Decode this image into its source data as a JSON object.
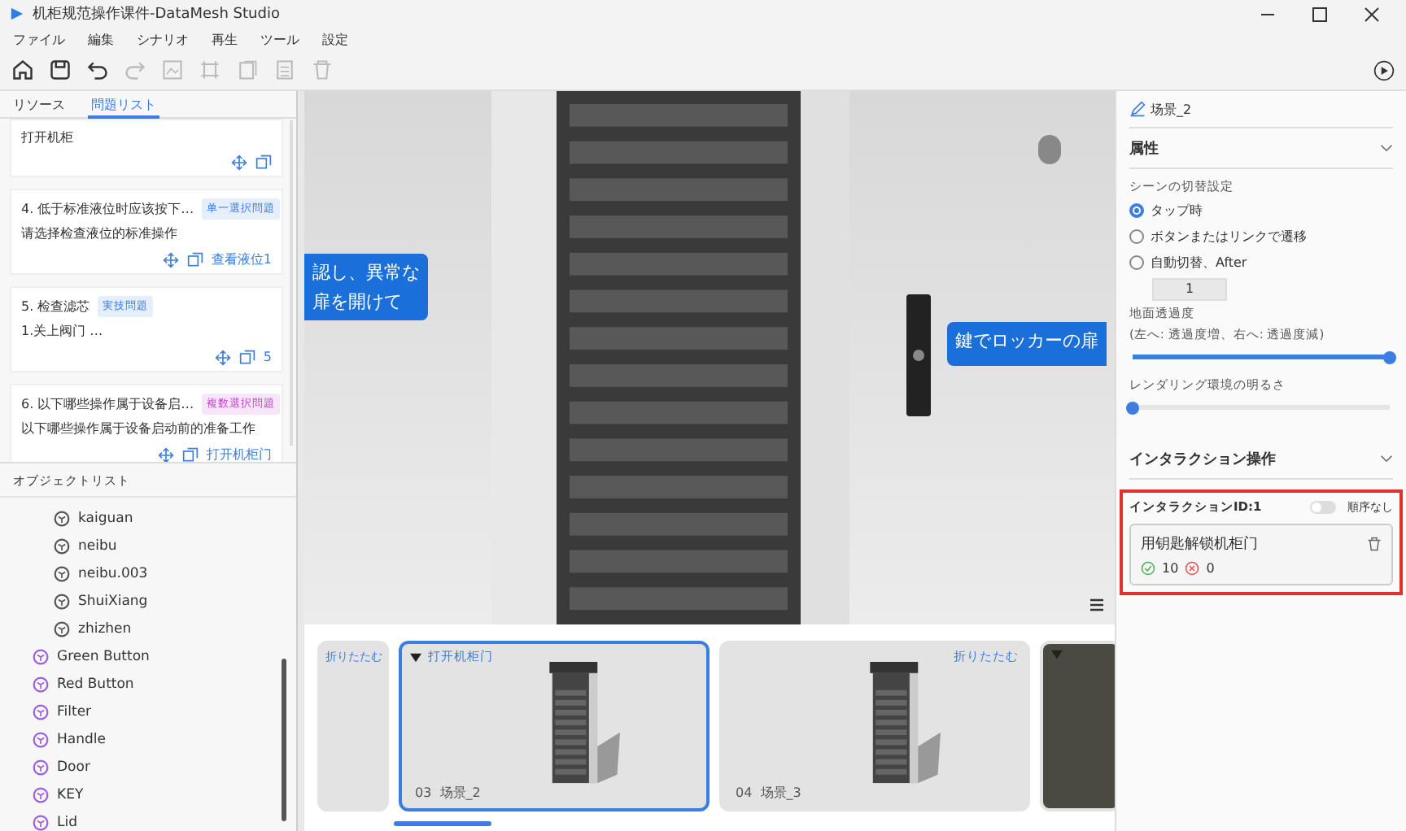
{
  "window": {
    "title": "机柜规范操作课件-DataMesh Studio"
  },
  "menu": [
    "ファイル",
    "編集",
    "シナリオ",
    "再生",
    "ツール",
    "設定"
  ],
  "toolbar": [
    {
      "kind": "home",
      "disabled": false
    },
    {
      "kind": "save",
      "disabled": false
    },
    {
      "kind": "undo",
      "disabled": false
    },
    {
      "kind": "redo",
      "disabled": true
    },
    {
      "kind": "image",
      "disabled": true
    },
    {
      "kind": "frame",
      "disabled": true
    },
    {
      "kind": "copy",
      "disabled": true
    },
    {
      "kind": "list",
      "disabled": true
    },
    {
      "kind": "trash",
      "disabled": true
    }
  ],
  "left_tabs": [
    {
      "label": "リソース",
      "selected": false
    },
    {
      "label": "問題リスト",
      "selected": true
    }
  ],
  "questions": [
    {
      "text": "打开机柜"
    },
    {
      "title": "4. 低于标准液位时应该按下…",
      "tag": "单一選択問題",
      "color": "#3b7de0",
      "text": "请选择检查液位的标准操作",
      "link": "查看液位1"
    },
    {
      "title": "5. 检查滤芯",
      "tag": "実技問題",
      "color": "#3b7de0",
      "text": "1.关上阀门 …",
      "link": "5"
    },
    {
      "title": "6. 以下哪些操作属于设备启…",
      "tag": "複数選択問題",
      "color": "#c040d0",
      "text": "以下哪些操作属于设备启动前的准备工作",
      "link": "打开机柜门"
    }
  ],
  "object_list": {
    "title": "オブジェクトリスト",
    "items": [
      {
        "children": [
          {
            "name": "kaiguan"
          },
          {
            "name": "neibu"
          },
          {
            "name": "neibu.003"
          },
          {
            "name": "ShuiXiang"
          },
          {
            "name": "zhizhen"
          }
        ]
      },
      {
        "name": "Green Button"
      },
      {
        "name": "Red Button"
      },
      {
        "name": "Filter"
      },
      {
        "name": "Handle"
      },
      {
        "name": "Door"
      },
      {
        "name": "KEY"
      },
      {
        "name": "Lid"
      }
    ]
  },
  "viewport": {
    "labels": [
      {
        "lines": [
          "認し、異常な",
          "扉を開けて"
        ]
      },
      {
        "lines": [
          "鍵でロッカーの扉"
        ]
      }
    ]
  },
  "scenes": [
    {
      "header": "折りたたむ",
      "caret": false,
      "selected": false,
      "kind": "partial"
    },
    {
      "header": "打开机柜门",
      "caret": true,
      "number": "03",
      "name": "场景_2",
      "selected": true,
      "kind": "cabinet"
    },
    {
      "header": "折りたたむ",
      "caret": false,
      "number": "04",
      "name": "场景_3",
      "selected": false,
      "kind": "cabinet"
    },
    {
      "caret": true,
      "selected": false,
      "kind": "closeup"
    }
  ],
  "properties": {
    "scene_name": "场景_2",
    "section": "属性",
    "expanded": true,
    "switch_label": "シーンの切替設定",
    "options": [
      {
        "label": "タップ時",
        "selected": true
      },
      {
        "label": "ボタンまたはリンクで遷移",
        "selected": false
      },
      {
        "label": "自動切替、After",
        "selected": false
      }
    ],
    "after_value": "1",
    "sliders": [
      {
        "label": "地面透過度",
        "hint": "(左へ: 透過度増、右へ: 透過度減)",
        "level": 1
      },
      {
        "label": "レンダリング環境の明るさ",
        "level": 0
      }
    ]
  },
  "interaction": {
    "section": "インタラクション操作",
    "id_label": "インタラクションID:1",
    "ordered": false,
    "order_label": "順序なし",
    "action": "用钥匙解锁机柜门",
    "success": "10",
    "failure": "0"
  }
}
